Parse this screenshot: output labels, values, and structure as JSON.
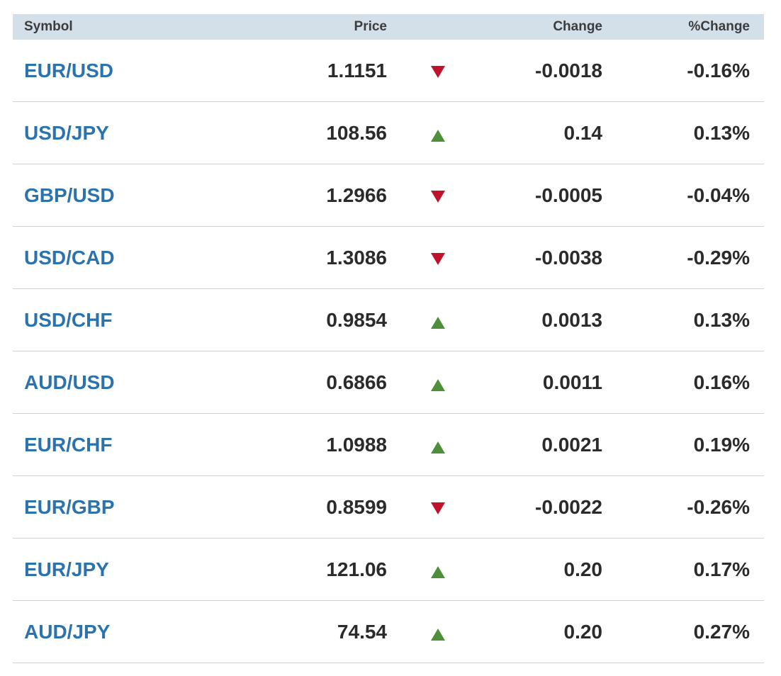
{
  "header": {
    "symbol": "Symbol",
    "price": "Price",
    "change": "Change",
    "pct_change": "%Change"
  },
  "colors": {
    "up": "#4e8f3a",
    "down": "#c1122b",
    "link": "#2c73ad",
    "header_bg": "#d3e0ea"
  },
  "rows": [
    {
      "symbol": "EUR/USD",
      "price": "1.1151",
      "direction": "down",
      "change": "-0.0018",
      "pct_change": "-0.16%"
    },
    {
      "symbol": "USD/JPY",
      "price": "108.56",
      "direction": "up",
      "change": "0.14",
      "pct_change": "0.13%"
    },
    {
      "symbol": "GBP/USD",
      "price": "1.2966",
      "direction": "down",
      "change": "-0.0005",
      "pct_change": "-0.04%"
    },
    {
      "symbol": "USD/CAD",
      "price": "1.3086",
      "direction": "down",
      "change": "-0.0038",
      "pct_change": "-0.29%"
    },
    {
      "symbol": "USD/CHF",
      "price": "0.9854",
      "direction": "up",
      "change": "0.0013",
      "pct_change": "0.13%"
    },
    {
      "symbol": "AUD/USD",
      "price": "0.6866",
      "direction": "up",
      "change": "0.0011",
      "pct_change": "0.16%"
    },
    {
      "symbol": "EUR/CHF",
      "price": "1.0988",
      "direction": "up",
      "change": "0.0021",
      "pct_change": "0.19%"
    },
    {
      "symbol": "EUR/GBP",
      "price": "0.8599",
      "direction": "down",
      "change": "-0.0022",
      "pct_change": "-0.26%"
    },
    {
      "symbol": "EUR/JPY",
      "price": "121.06",
      "direction": "up",
      "change": "0.20",
      "pct_change": "0.17%"
    },
    {
      "symbol": "AUD/JPY",
      "price": "74.54",
      "direction": "up",
      "change": "0.20",
      "pct_change": "0.27%"
    }
  ]
}
